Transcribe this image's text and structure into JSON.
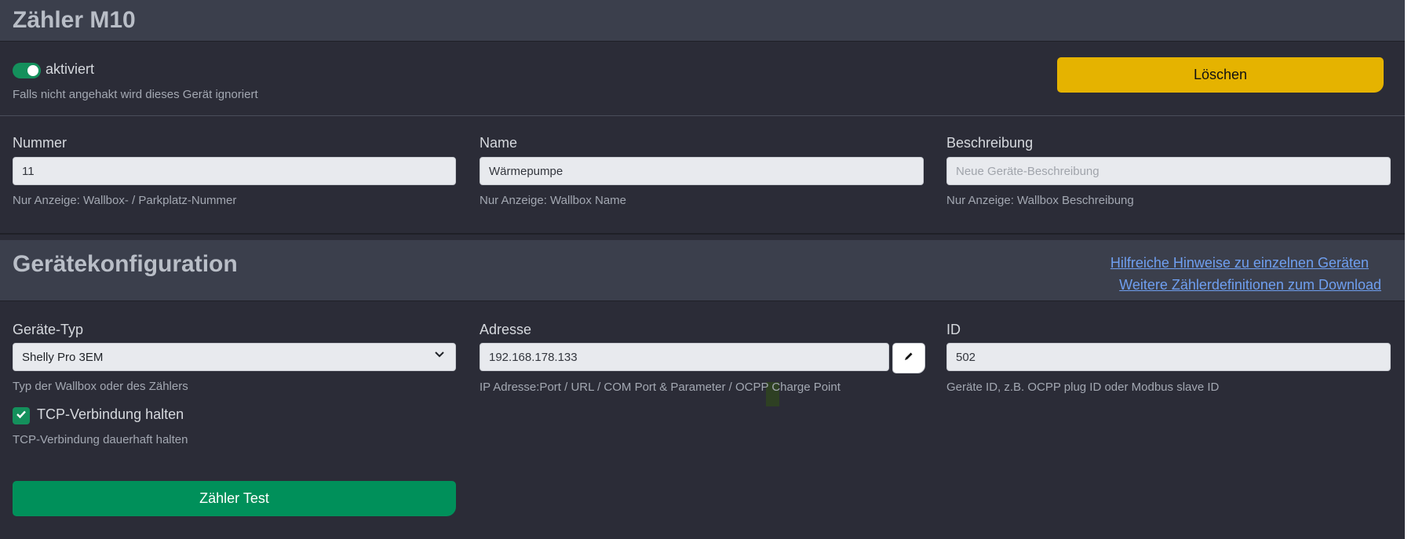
{
  "meter": {
    "title": "Zähler M10",
    "enabled_label": "aktiviert",
    "enabled": true,
    "enabled_help": "Falls nicht angehakt wird dieses Gerät ignoriert",
    "delete_label": "Löschen",
    "fields": {
      "number": {
        "label": "Nummer",
        "value": "11",
        "help": "Nur Anzeige: Wallbox- / Parkplatz-Nummer"
      },
      "name": {
        "label": "Name",
        "value": "Wärmepumpe",
        "help": "Nur Anzeige: Wallbox Name"
      },
      "description": {
        "label": "Beschreibung",
        "value": "",
        "placeholder": "Neue Geräte-Beschreibung",
        "help": "Nur Anzeige: Wallbox Beschreibung"
      }
    }
  },
  "config": {
    "title": "Gerätekonfiguration",
    "links": [
      "Hilfreiche Hinweise zu einzelnen Geräten",
      "Weitere Zählerdefinitionen zum Download"
    ],
    "device_type": {
      "label": "Geräte-Typ",
      "value": "Shelly Pro 3EM",
      "help": "Typ der Wallbox oder des Zählers"
    },
    "address": {
      "label": "Adresse",
      "value": "192.168.178.133",
      "help": "IP Adresse:Port / URL / COM Port & Parameter / OCPP Charge Point"
    },
    "id": {
      "label": "ID",
      "value": "502",
      "help": "Geräte ID, z.B. OCPP plug ID oder Modbus slave ID"
    },
    "tcp_keep": {
      "label": "TCP-Verbindung halten",
      "checked": true,
      "help": "TCP-Verbindung dauerhaft halten"
    },
    "test_label": "Zähler Test"
  },
  "colors": {
    "accent_green": "#00905a",
    "accent_yellow": "#e5b300",
    "link": "#6f9ff0",
    "background": "#2b2c37",
    "header": "#3b3f4c"
  },
  "icons": {
    "edit": "pencil-icon",
    "dropdown": "chevron-down-icon",
    "check": "check-icon"
  }
}
